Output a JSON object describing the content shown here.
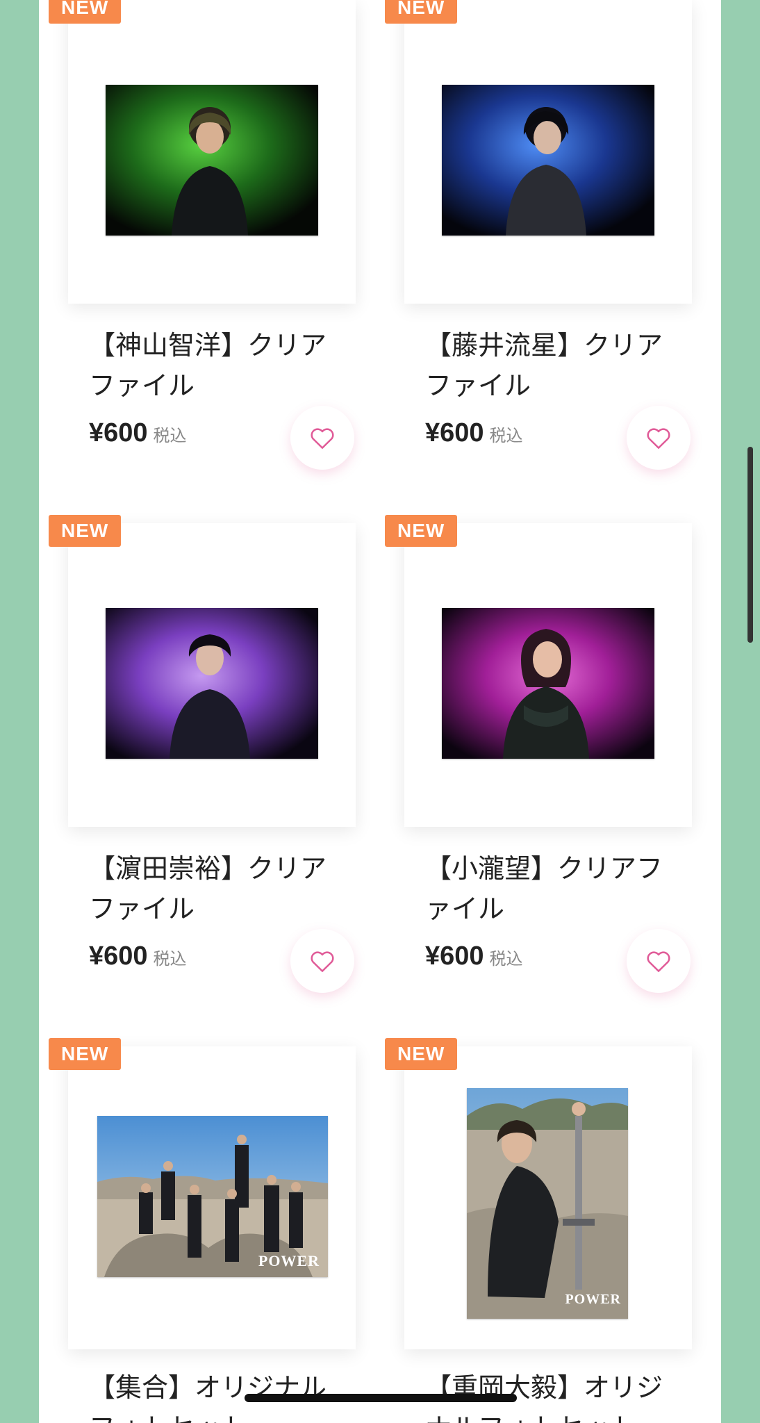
{
  "badge_label": "NEW",
  "products": [
    {
      "title": "【神山智洋】クリアファイル",
      "price": "¥600",
      "tax": "税込"
    },
    {
      "title": "【藤井流星】クリアファイル",
      "price": "¥600",
      "tax": "税込"
    },
    {
      "title": "【濵田崇裕】クリアファイル",
      "price": "¥600",
      "tax": "税込"
    },
    {
      "title": "【小瀧望】クリアファイル",
      "price": "¥600",
      "tax": "税込"
    },
    {
      "title": "【集合】オリジナルフォトセット"
    },
    {
      "title": "【重岡大毅】オリジナルフォトセット"
    }
  ],
  "photo_logo": "POWER",
  "colors": {
    "background": "#97ceb0",
    "badge": "#f7894b",
    "heart": "#e05a97",
    "smoke_green": "#3fb23a",
    "smoke_blue": "#2b5fd0",
    "smoke_purple": "#8d4fd0",
    "smoke_magenta": "#c02fb2"
  }
}
